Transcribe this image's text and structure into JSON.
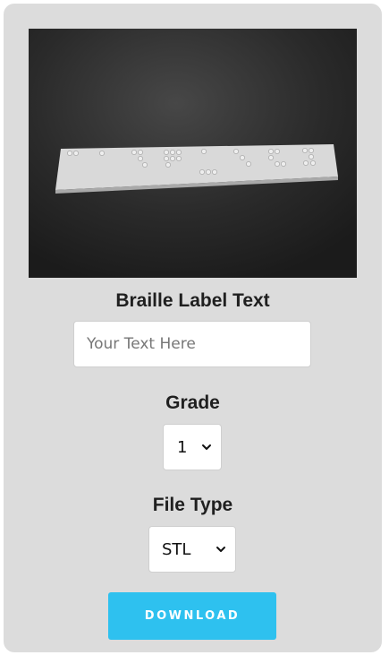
{
  "photo": {
    "icon": "braille-label-photo"
  },
  "form": {
    "text_heading": "Braille Label Text",
    "text_placeholder": "Your Text Here",
    "grade_heading": "Grade",
    "grade_value": "1",
    "filetype_heading": "File Type",
    "filetype_value": "STL",
    "download_label": "DOWNLOAD"
  },
  "colors": {
    "card_background": "#dcdcdc",
    "button_accent": "#2ec1ef",
    "heading_text": "#1f1f1f"
  }
}
